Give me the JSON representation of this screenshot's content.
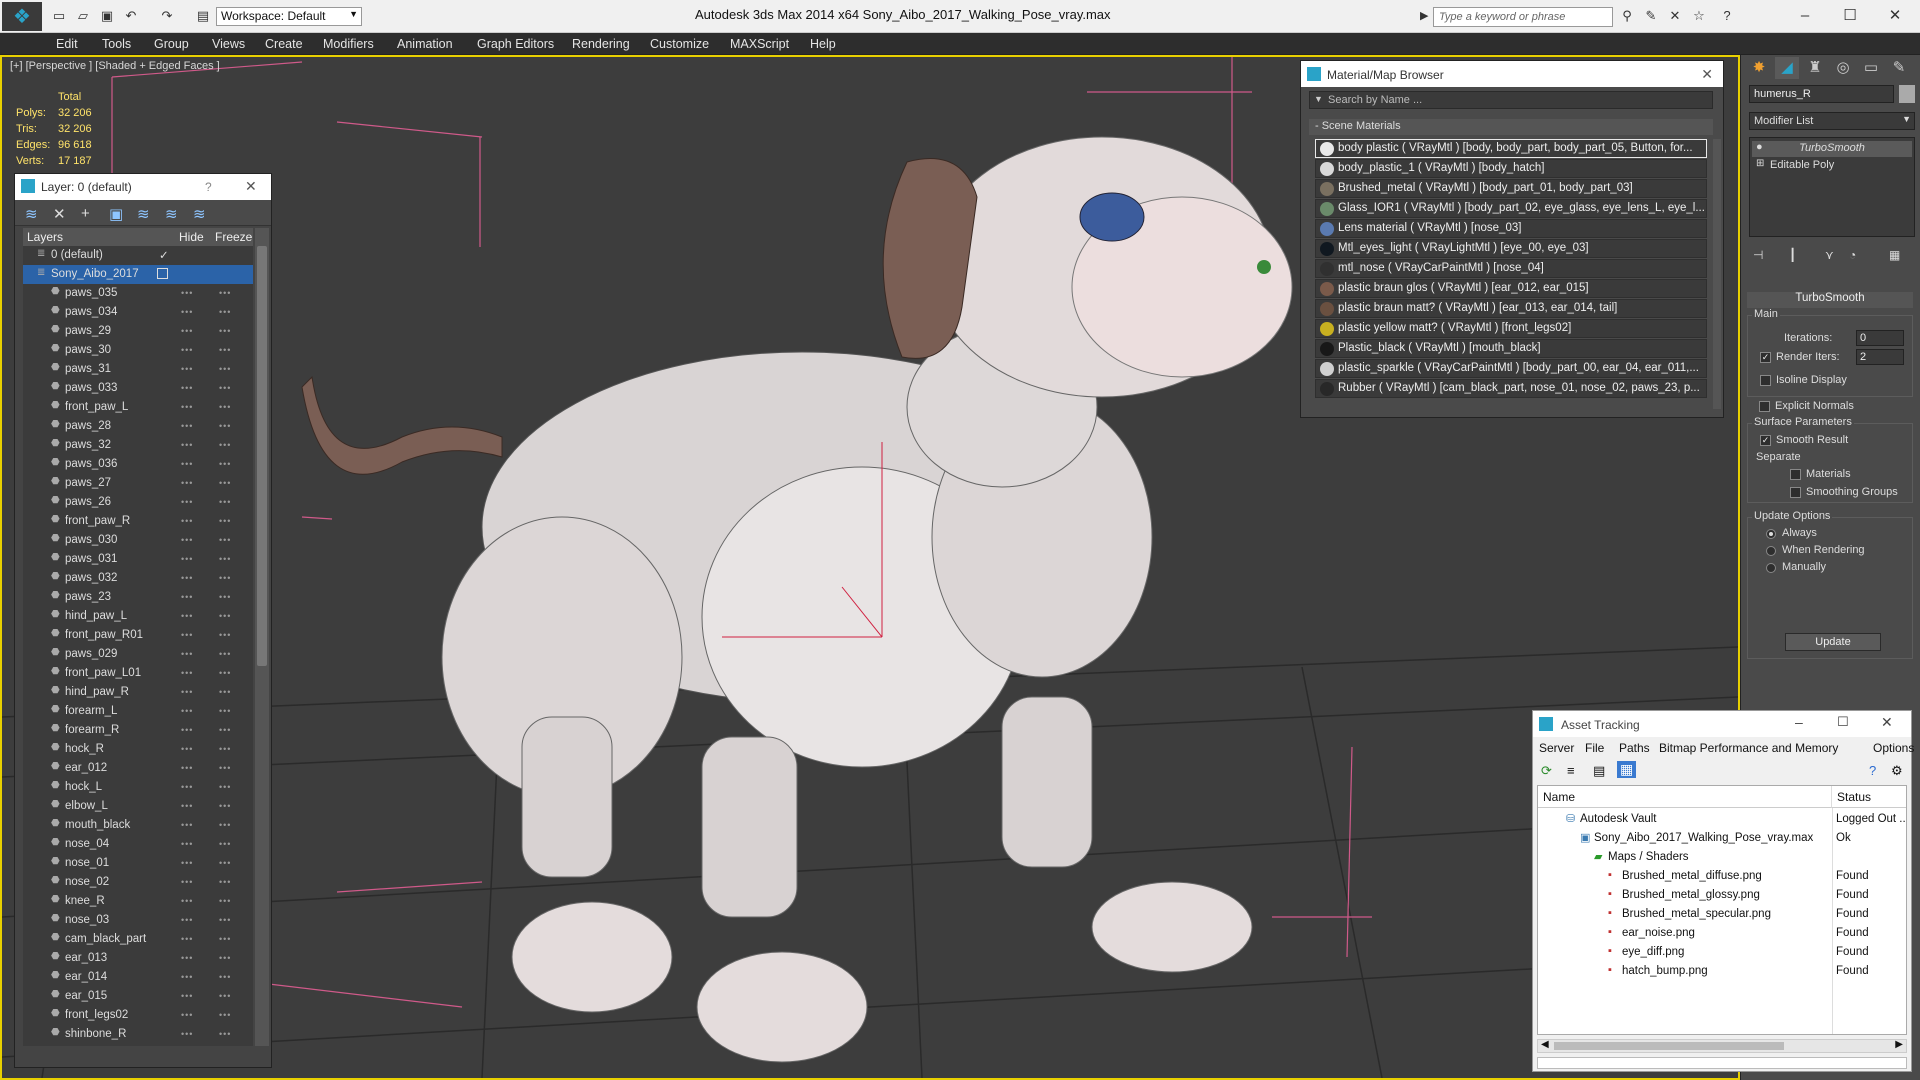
{
  "title_bar": {
    "app_title": "Autodesk 3ds Max  2014 x64      Sony_Aibo_2017_Walking_Pose_vray.max",
    "workspace": "Workspace: Default",
    "search_placeholder": "Type a keyword or phrase"
  },
  "menu": [
    "Edit",
    "Tools",
    "Group",
    "Views",
    "Create",
    "Modifiers",
    "Animation",
    "Graph Editors",
    "Rendering",
    "Customize",
    "MAXScript",
    "Help"
  ],
  "viewport": {
    "label": "[+] [Perspective ] [Shaded + Edged Faces ]",
    "stats": {
      "header": "Total",
      "rows": [
        {
          "label": "Polys:",
          "value": "32 206"
        },
        {
          "label": "Tris:",
          "value": "32 206"
        },
        {
          "label": "Edges:",
          "value": "96 618"
        },
        {
          "label": "Verts:",
          "value": "17 187"
        }
      ]
    }
  },
  "layer_panel": {
    "title": "Layer: 0 (default)",
    "help": "?",
    "columns": {
      "layers": "Layers",
      "hide": "Hide",
      "freeze": "Freeze"
    },
    "layers": [
      {
        "name": "0 (default)",
        "level": 0,
        "checked": true
      },
      {
        "name": "Sony_Aibo_2017",
        "level": 0,
        "selected": true
      },
      {
        "name": "paws_035",
        "level": 1
      },
      {
        "name": "paws_034",
        "level": 1
      },
      {
        "name": "paws_29",
        "level": 1
      },
      {
        "name": "paws_30",
        "level": 1
      },
      {
        "name": "paws_31",
        "level": 1
      },
      {
        "name": "paws_033",
        "level": 1
      },
      {
        "name": "front_paw_L",
        "level": 1
      },
      {
        "name": "paws_28",
        "level": 1
      },
      {
        "name": "paws_32",
        "level": 1
      },
      {
        "name": "paws_036",
        "level": 1
      },
      {
        "name": "paws_27",
        "level": 1
      },
      {
        "name": "paws_26",
        "level": 1
      },
      {
        "name": "front_paw_R",
        "level": 1
      },
      {
        "name": "paws_030",
        "level": 1
      },
      {
        "name": "paws_031",
        "level": 1
      },
      {
        "name": "paws_032",
        "level": 1
      },
      {
        "name": "paws_23",
        "level": 1
      },
      {
        "name": "hind_paw_L",
        "level": 1
      },
      {
        "name": "front_paw_R01",
        "level": 1
      },
      {
        "name": "paws_029",
        "level": 1
      },
      {
        "name": "front_paw_L01",
        "level": 1
      },
      {
        "name": "hind_paw_R",
        "level": 1
      },
      {
        "name": "forearm_L",
        "level": 1
      },
      {
        "name": "forearm_R",
        "level": 1
      },
      {
        "name": "hock_R",
        "level": 1
      },
      {
        "name": "ear_012",
        "level": 1
      },
      {
        "name": "hock_L",
        "level": 1
      },
      {
        "name": "elbow_L",
        "level": 1
      },
      {
        "name": "mouth_black",
        "level": 1
      },
      {
        "name": "nose_04",
        "level": 1
      },
      {
        "name": "nose_01",
        "level": 1
      },
      {
        "name": "nose_02",
        "level": 1
      },
      {
        "name": "knee_R",
        "level": 1
      },
      {
        "name": "nose_03",
        "level": 1
      },
      {
        "name": "cam_black_part",
        "level": 1
      },
      {
        "name": "ear_013",
        "level": 1
      },
      {
        "name": "ear_014",
        "level": 1
      },
      {
        "name": "ear_015",
        "level": 1
      },
      {
        "name": "front_legs02",
        "level": 1
      },
      {
        "name": "shinbone_R",
        "level": 1
      }
    ]
  },
  "material_browser": {
    "title": "Material/Map Browser",
    "search_placeholder": "Search by Name ...",
    "section": "- Scene Materials",
    "materials": [
      {
        "text": "body plastic  ( VRayMtl ) [body, body_part, body_part_05, Button, for...",
        "color": "#e8e8e8"
      },
      {
        "text": "body_plastic_1  ( VRayMtl ) [body_hatch]",
        "color": "#d8d8d8"
      },
      {
        "text": "Brushed_metal  ( VRayMtl ) [body_part_01, body_part_03]",
        "color": "#7a7060"
      },
      {
        "text": "Glass_IOR1  ( VRayMtl ) [body_part_02, eye_glass, eye_lens_L, eye_l...",
        "color": "#6a8a6a"
      },
      {
        "text": "Lens material  ( VRayMtl ) [nose_03]",
        "color": "#5a7ab0"
      },
      {
        "text": "Mtl_eyes_light  ( VRayLightMtl ) [eye_00, eye_03]",
        "color": "#101820"
      },
      {
        "text": "mtl_nose  ( VRayCarPaintMtl ) [nose_04]",
        "color": "#303030"
      },
      {
        "text": "plastic braun glos  ( VRayMtl ) [ear_012, ear_015]",
        "color": "#7a5a4a"
      },
      {
        "text": "plastic braun matt?  ( VRayMtl ) [ear_013, ear_014, tail]",
        "color": "#6a5040"
      },
      {
        "text": "plastic yellow matt?  ( VRayMtl ) [front_legs02]",
        "color": "#c8b020"
      },
      {
        "text": "Plastic_black  ( VRayMtl ) [mouth_black]",
        "color": "#181818"
      },
      {
        "text": "plastic_sparkle  ( VRayCarPaintMtl ) [body_part_00, ear_04, ear_011,...",
        "color": "#d0d0d0"
      },
      {
        "text": "Rubber  ( VRayMtl ) [cam_black_part, nose_01, nose_02, paws_23, p...",
        "color": "#282828"
      }
    ]
  },
  "command_panel": {
    "object_name": "humerus_R",
    "modifier_list": "Modifier List",
    "stack": [
      "TurboSmooth",
      "Editable Poly"
    ],
    "turbosmooth": {
      "title": "TurboSmooth",
      "main": "Main",
      "iterations_label": "Iterations:",
      "iterations": "0",
      "render_iters_label": "Render Iters:",
      "render_iters": "2",
      "isoline": "Isoline Display",
      "explicit": "Explicit Normals",
      "surface": "Surface Parameters",
      "smooth_result": "Smooth Result",
      "separate": "Separate",
      "materials": "Materials",
      "smoothing_groups": "Smoothing Groups",
      "update_options": "Update Options",
      "always": "Always",
      "when_rendering": "When Rendering",
      "manually": "Manually",
      "update": "Update"
    }
  },
  "asset_tracking": {
    "title": "Asset Tracking",
    "menu": [
      "Server",
      "File",
      "Paths",
      "Bitmap Performance and Memory",
      "Options"
    ],
    "columns": {
      "name": "Name",
      "status": "Status"
    },
    "rows": [
      {
        "name": "Autodesk Vault",
        "status": "Logged Out ...",
        "level": 1
      },
      {
        "name": "Sony_Aibo_2017_Walking_Pose_vray.max",
        "status": "Ok",
        "level": 2
      },
      {
        "name": "Maps / Shaders",
        "status": "",
        "level": 3
      },
      {
        "name": "Brushed_metal_diffuse.png",
        "status": "Found",
        "level": 4
      },
      {
        "name": "Brushed_metal_glossy.png",
        "status": "Found",
        "level": 4
      },
      {
        "name": "Brushed_metal_specular.png",
        "status": "Found",
        "level": 4
      },
      {
        "name": "ear_noise.png",
        "status": "Found",
        "level": 4
      },
      {
        "name": "eye_diff.png",
        "status": "Found",
        "level": 4
      },
      {
        "name": "hatch_bump.png",
        "status": "Found",
        "level": 4
      }
    ]
  }
}
